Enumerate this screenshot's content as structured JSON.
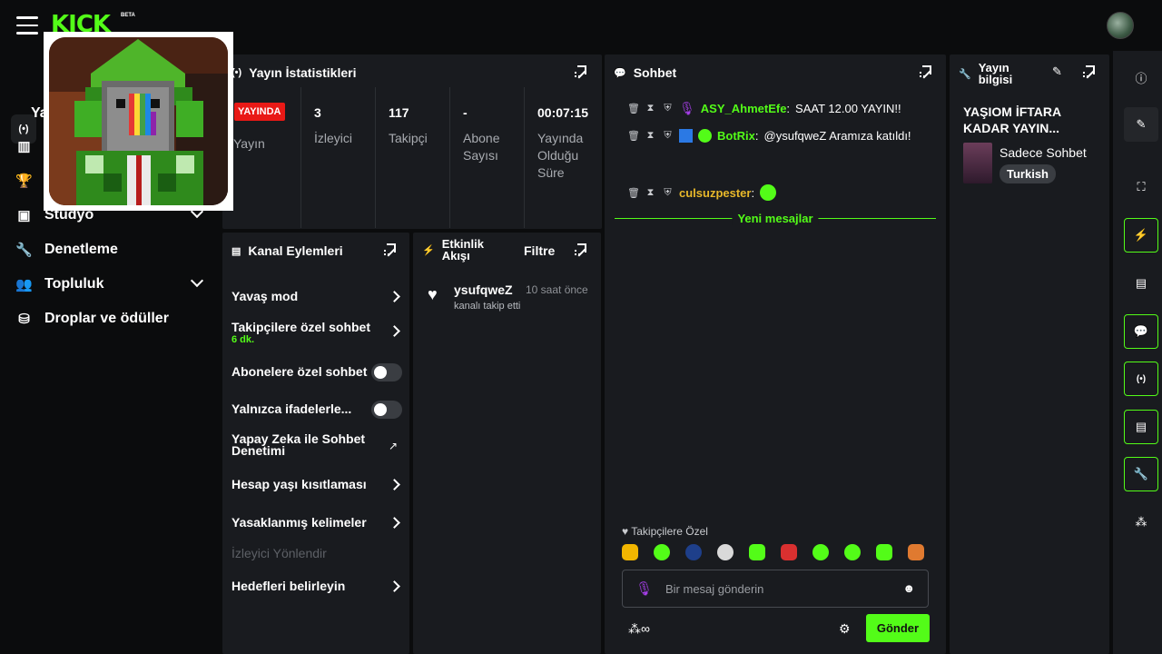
{
  "brand": {
    "logo": "KICK",
    "beta": "BETA",
    "accent": "#53fc18"
  },
  "sidebar": {
    "items": [
      {
        "label": "Ya",
        "icon": "broadcast-icon"
      },
      {
        "label": "Stüdyo",
        "icon": "studio-icon"
      },
      {
        "label": "Denetleme",
        "icon": "wrench-icon"
      },
      {
        "label": "Topluluk",
        "icon": "community-icon"
      },
      {
        "label": "Droplar ve ödüller",
        "icon": "drops-icon"
      }
    ]
  },
  "stats": {
    "title": "Yayın İstatistikleri",
    "live_badge": "YAYINDA",
    "columns": [
      {
        "value": "",
        "label": "Yayın"
      },
      {
        "value": "3",
        "label": "İzleyici"
      },
      {
        "value": "117",
        "label": "Takipçi"
      },
      {
        "value": "-",
        "label": "Abone Sayısı"
      },
      {
        "value": "00:07:15",
        "label": "Yayında Olduğu Süre"
      }
    ]
  },
  "channel_actions": {
    "title": "Kanal Eylemleri",
    "rows": [
      {
        "label": "Yavaş mod"
      },
      {
        "label": "Takipçilere özel sohbet",
        "sub": "6 dk."
      },
      {
        "label": "Abonelere özel sohbet"
      },
      {
        "label": "Yalnızca ifadelerle..."
      },
      {
        "label": "Yapay Zeka ile Sohbet Denetimi"
      },
      {
        "label": "Hesap yaşı kısıtlaması"
      },
      {
        "label": "Yasaklanmış kelimeler"
      },
      {
        "label": "İzleyici Yönlendir"
      },
      {
        "label": "Hedefleri belirleyin"
      }
    ]
  },
  "activity": {
    "title": "Etkinlik Akışı",
    "filter": "Filtre",
    "events": [
      {
        "user": "ysufqweZ",
        "time": "10 saat önce",
        "desc": "kanalı takip etti"
      }
    ]
  },
  "chat": {
    "title": "Sohbet",
    "messages": [
      {
        "user": "ASY_AhmetEfe",
        "text": "SAAT 12.00 YAYIN!!",
        "color": "#53fc18"
      },
      {
        "user": "BotRix",
        "text": "@ysufqweZ Aramıza katıldı!",
        "color": "#53fc18"
      },
      {
        "user": "culsuzpester",
        "text": "",
        "color": "#e8b82a"
      }
    ],
    "new_messages": "Yeni mesajlar",
    "followers_only": "Takipçilere Özel",
    "placeholder": "Bir mesaj gönderin",
    "send": "Gönder"
  },
  "stream_info": {
    "title": "Yayın bilgisi",
    "stream_title": "YAŞIOM İFTARA KADAR YAYIN...",
    "category": "Sadece Sohbet",
    "tag": "Turkish"
  }
}
